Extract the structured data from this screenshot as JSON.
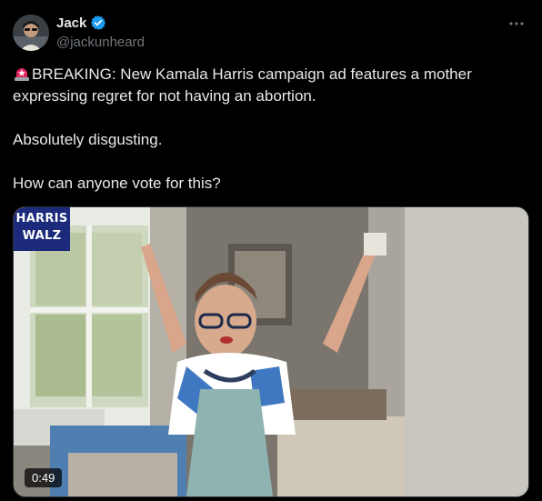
{
  "author": {
    "display_name": "Jack",
    "handle": "@jackunheard",
    "verified_icon": "verified-badge-icon",
    "verified_color": "#1d9bf0"
  },
  "tweet": {
    "line1": "BREAKING: New Kamala Harris campaign ad features a mother expressing regret for not having an abortion.",
    "line2": "Absolutely disgusting.",
    "line3": "How can anyone vote for this?",
    "emoji_icon": "police-light-icon"
  },
  "media": {
    "overlay_top": "HARRIS",
    "overlay_bottom": "WALZ",
    "duration": "0:49",
    "overlay_color": "#1b2a7a"
  },
  "colors": {
    "background": "#000000",
    "text_primary": "#e7e9ea",
    "text_secondary": "#71767b"
  }
}
